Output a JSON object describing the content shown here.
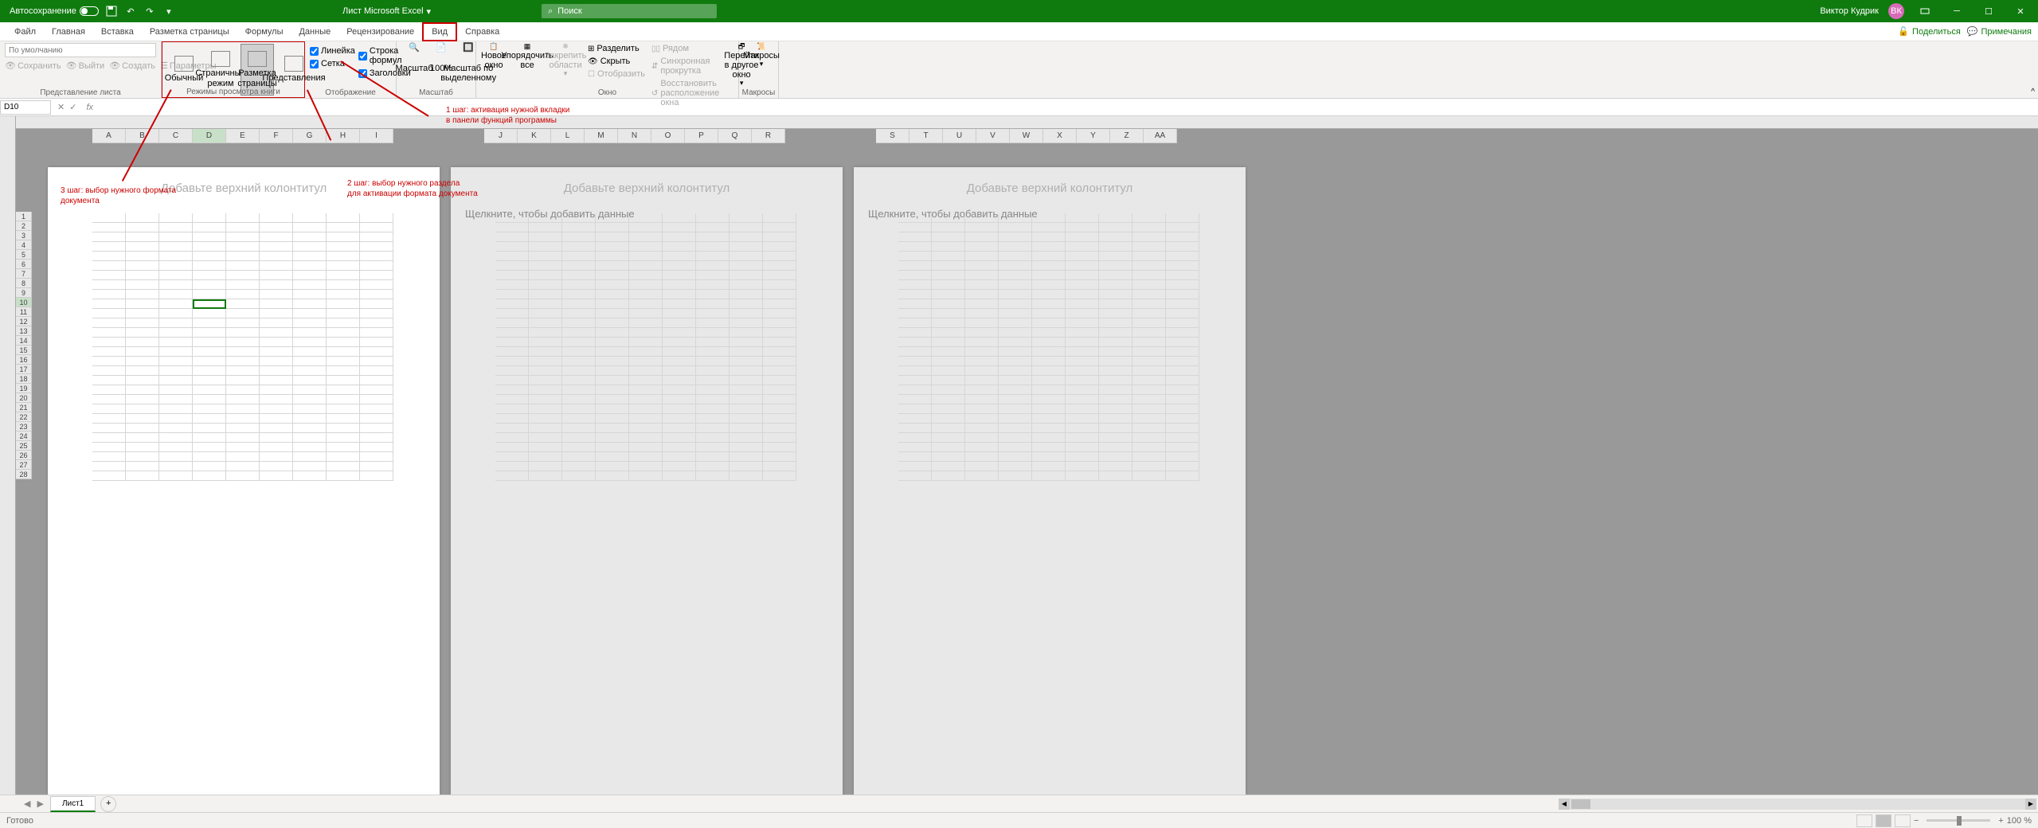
{
  "titlebar": {
    "autosave": "Автосохранение",
    "title": "Лист Microsoft Excel",
    "search_placeholder": "Поиск",
    "user": "Виктор Кудрик",
    "user_initials": "ВК"
  },
  "tabs": {
    "items": [
      "Файл",
      "Главная",
      "Вставка",
      "Разметка страницы",
      "Формулы",
      "Данные",
      "Рецензирование",
      "Вид",
      "Справка"
    ],
    "active": "Вид",
    "share": "Поделиться",
    "comments": "Примечания"
  },
  "ribbon": {
    "sheet_views": {
      "dropdown": "По умолчанию",
      "keep": "Сохранить",
      "exit": "Выйти",
      "new": "Создать",
      "params": "Параметры",
      "label": "Представление листа"
    },
    "book_views": {
      "normal": "Обычный",
      "page_break": "Страничный режим",
      "page_layout": "Разметка страницы",
      "custom": "Представления",
      "label": "Режимы просмотра книги"
    },
    "show": {
      "ruler": "Линейка",
      "formula_bar": "Строка формул",
      "gridlines": "Сетка",
      "headings": "Заголовки",
      "label": "Отображение"
    },
    "zoom": {
      "zoom": "Масштаб",
      "hundred": "100%",
      "selection": "Масштаб по выделенному",
      "label": "Масштаб"
    },
    "window": {
      "new_window": "Новое окно",
      "arrange": "Упорядочить все",
      "freeze": "Закрепить области",
      "split": "Разделить",
      "hide": "Скрыть",
      "unhide": "Отобразить",
      "side_by_side": "Рядом",
      "sync_scroll": "Синхронная прокрутка",
      "reset_pos": "Восстановить расположение окна",
      "switch": "Перейти в другое окно",
      "label": "Окно"
    },
    "macros": {
      "macros": "Макросы",
      "label": "Макросы"
    }
  },
  "namebox": {
    "cell": "D10"
  },
  "columns": [
    "A",
    "B",
    "C",
    "D",
    "E",
    "F",
    "G",
    "H",
    "I"
  ],
  "columns2": [
    "J",
    "K",
    "L",
    "M",
    "N",
    "O",
    "P",
    "Q",
    "R"
  ],
  "columns3": [
    "S",
    "T",
    "U",
    "V",
    "W",
    "X",
    "Y",
    "Z",
    "AA"
  ],
  "rows": [
    1,
    2,
    3,
    4,
    5,
    6,
    7,
    8,
    9,
    10,
    11,
    12,
    13,
    14,
    15,
    16,
    17,
    18,
    19,
    20,
    21,
    22,
    23,
    24,
    25,
    26,
    27,
    28
  ],
  "page": {
    "header_hint": "Добавьте верхний колонтитул",
    "data_hint": "Щелкните, чтобы добавить данные"
  },
  "sheets": {
    "tab1": "Лист1"
  },
  "statusbar": {
    "ready": "Готово",
    "zoom": "100 %"
  },
  "annotations": {
    "a1": "1 шаг: активация нужной вкладки\nв панели функций программы",
    "a2": "2 шаг: выбор нужного раздела\nдля активации формата документа",
    "a3": "3 шаг: выбор нужного формата\nдокумента"
  }
}
